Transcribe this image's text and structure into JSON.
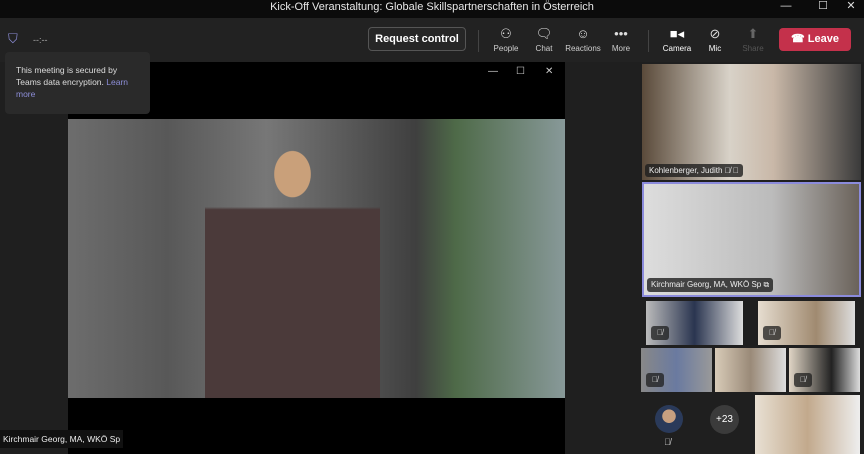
{
  "window": {
    "title": "Kick-Off Veranstaltung: Globale Skillspartnerschaften in Österreich",
    "minimize": "—",
    "maximize": "☐",
    "close": "✕"
  },
  "toolbar": {
    "timer": "--:--",
    "request_control": "Request control",
    "people": "People",
    "chat": "Chat",
    "reactions": "Reactions",
    "more": "More",
    "camera": "Camera",
    "mic": "Mic",
    "share": "Share",
    "leave": "Leave"
  },
  "tooltip": {
    "text": "This meeting is secured by Teams data encryption.",
    "link": "Learn more"
  },
  "stage": {
    "presenter_name": "Kirchmair Georg, MA, WKÖ Sp",
    "min": "—",
    "max": "☐",
    "close": "✕"
  },
  "gallery": {
    "tiles": [
      {
        "name": "Kohlenberger, Judith"
      },
      {
        "name": "Kirchmair Georg, MA, WKÖ Sp"
      }
    ],
    "overflow_count": "+23"
  },
  "colors": {
    "leave": "#c4314b",
    "active_border": "#8b8bdc",
    "link": "#8d8ed8"
  }
}
